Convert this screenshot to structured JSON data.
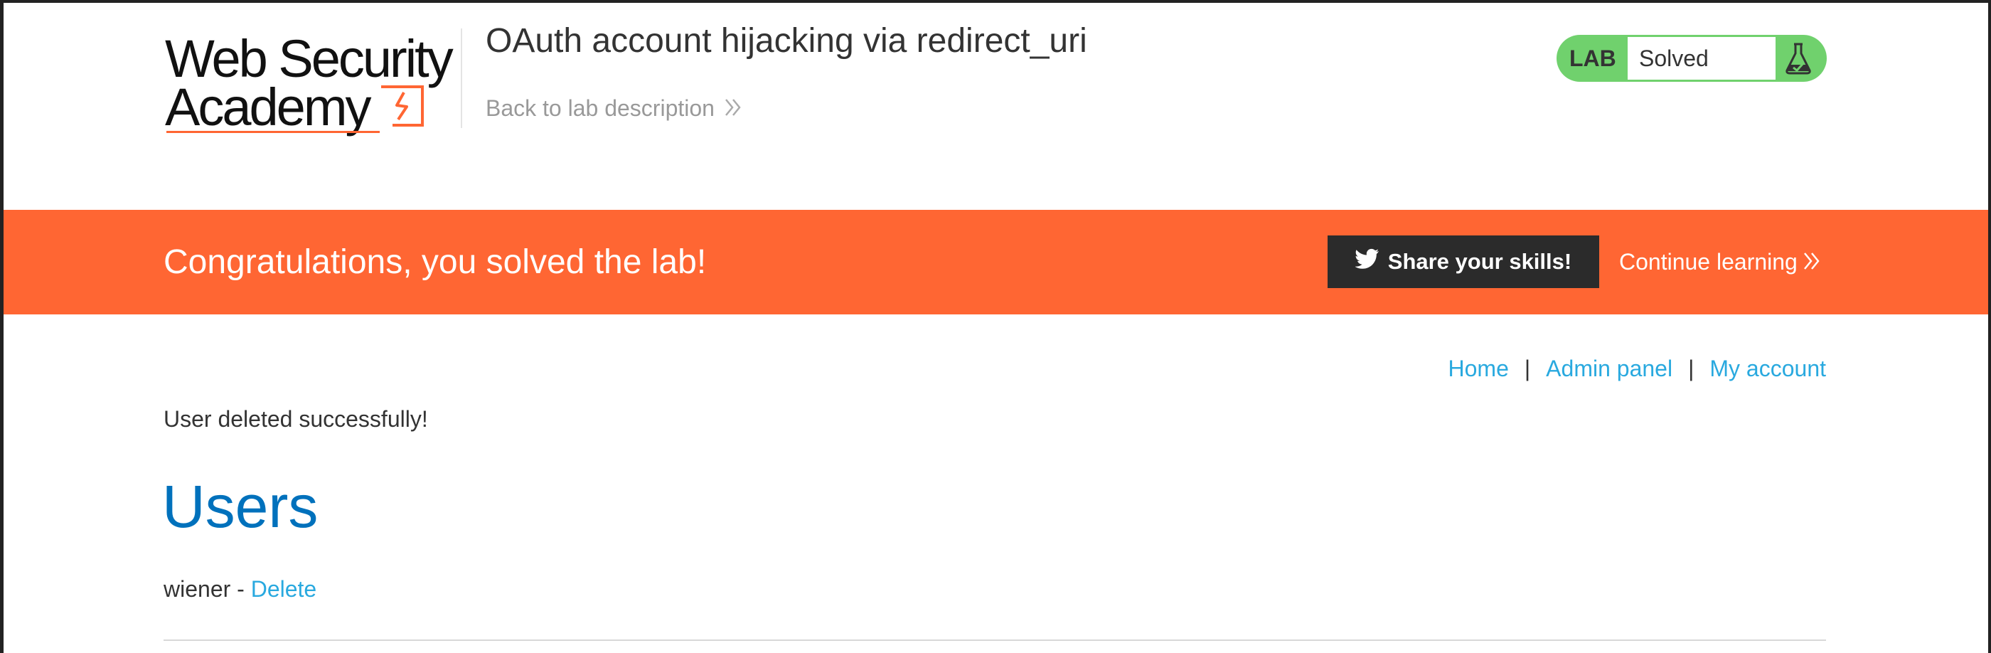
{
  "header": {
    "logo": {
      "line1": "Web Security",
      "line2": "Academy"
    },
    "lab_title": "OAuth account hijacking via redirect_uri",
    "back_link": "Back to lab description"
  },
  "lab_status": {
    "label": "LAB",
    "status": "Solved",
    "icon": "flask-icon"
  },
  "banner": {
    "message": "Congratulations, you solved the lab!",
    "share_label": "Share your skills!",
    "share_icon": "twitter-icon",
    "continue_label": "Continue learning",
    "background": "#ff6633"
  },
  "nav": {
    "items": [
      {
        "label": "Home"
      },
      {
        "label": "Admin panel"
      },
      {
        "label": "My account"
      }
    ],
    "separator": "|"
  },
  "main": {
    "message": "User deleted successfully!",
    "heading": "Users",
    "users": [
      {
        "name": "wiener",
        "separator": " - ",
        "action": "Delete"
      }
    ]
  },
  "colors": {
    "accent": "#ff6633",
    "link": "#29a9df",
    "heading": "#0071bc",
    "solved": "#70d16d"
  }
}
